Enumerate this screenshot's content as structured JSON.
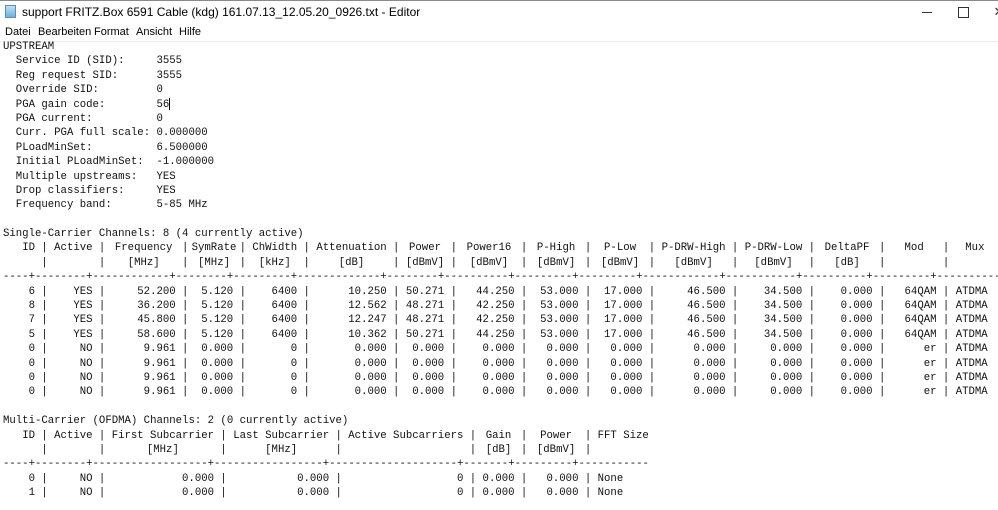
{
  "window": {
    "title": "support FRITZ.Box 6591 Cable (kdg) 161.07.13_12.05.20_0926.txt - Editor",
    "controls": [
      "minimize",
      "maximize",
      "close"
    ]
  },
  "menu": [
    "Datei",
    "Bearbeiten",
    "Format",
    "Ansicht",
    "Hilfe"
  ],
  "document": {
    "heading": "UPSTREAM",
    "settings": [
      {
        "label": "Service ID (SID):",
        "value": "3555"
      },
      {
        "label": "Reg request SID:",
        "value": "3555"
      },
      {
        "label": "Override SID:",
        "value": "0"
      },
      {
        "label": "PGA gain code:",
        "value": "56"
      },
      {
        "label": "PGA current:",
        "value": "0"
      },
      {
        "label": "Curr. PGA full scale:",
        "value": "0.000000"
      },
      {
        "label": "PLoadMinSet:",
        "value": "6.500000"
      },
      {
        "label": "Initial PLoadMinSet:",
        "value": "-1.000000"
      },
      {
        "label": "Multiple upstreams:",
        "value": "YES"
      },
      {
        "label": "Drop classifiers:",
        "value": "YES"
      },
      {
        "label": "Frequency band:",
        "value": "5-85 MHz"
      }
    ],
    "single_carrier": {
      "title": "Single-Carrier Channels: 8 (4 currently active)",
      "headers": [
        "ID",
        "Active",
        "Frequency",
        "SymRate",
        "ChWidth",
        "Attenuation",
        "Power",
        "Power16",
        "P-High",
        "P-Low",
        "P-DRW-High",
        "P-DRW-Low",
        "DeltaPF",
        "Mod",
        "Mux"
      ],
      "units": [
        "",
        "",
        "[MHz]",
        "[MHz]",
        "[kHz]",
        "[dB]",
        "[dBmV]",
        "[dBmV]",
        "[dBmV]",
        "[dBmV]",
        "[dBmV]",
        "[dBmV]",
        "[dB]",
        "",
        ""
      ],
      "rows": [
        [
          "6",
          "YES",
          "52.200",
          "5.120",
          "6400",
          "10.250",
          "50.271",
          "44.250",
          "53.000",
          "17.000",
          "46.500",
          "34.500",
          "0.000",
          "64QAM",
          "ATDMA"
        ],
        [
          "8",
          "YES",
          "36.200",
          "5.120",
          "6400",
          "12.562",
          "48.271",
          "42.250",
          "53.000",
          "17.000",
          "46.500",
          "34.500",
          "0.000",
          "64QAM",
          "ATDMA"
        ],
        [
          "7",
          "YES",
          "45.800",
          "5.120",
          "6400",
          "12.247",
          "48.271",
          "42.250",
          "53.000",
          "17.000",
          "46.500",
          "34.500",
          "0.000",
          "64QAM",
          "ATDMA"
        ],
        [
          "5",
          "YES",
          "58.600",
          "5.120",
          "6400",
          "10.362",
          "50.271",
          "44.250",
          "53.000",
          "17.000",
          "46.500",
          "34.500",
          "0.000",
          "64QAM",
          "ATDMA"
        ],
        [
          "0",
          "NO",
          "9.961",
          "0.000",
          "0",
          "0.000",
          "0.000",
          "0.000",
          "0.000",
          "0.000",
          "0.000",
          "0.000",
          "0.000",
          "er",
          "ATDMA"
        ],
        [
          "0",
          "NO",
          "9.961",
          "0.000",
          "0",
          "0.000",
          "0.000",
          "0.000",
          "0.000",
          "0.000",
          "0.000",
          "0.000",
          "0.000",
          "er",
          "ATDMA"
        ],
        [
          "0",
          "NO",
          "9.961",
          "0.000",
          "0",
          "0.000",
          "0.000",
          "0.000",
          "0.000",
          "0.000",
          "0.000",
          "0.000",
          "0.000",
          "er",
          "ATDMA"
        ],
        [
          "0",
          "NO",
          "9.961",
          "0.000",
          "0",
          "0.000",
          "0.000",
          "0.000",
          "0.000",
          "0.000",
          "0.000",
          "0.000",
          "0.000",
          "er",
          "ATDMA"
        ]
      ]
    },
    "multi_carrier": {
      "title": "Multi-Carrier (OFDMA) Channels: 2 (0 currently active)",
      "headers": [
        "ID",
        "Active",
        "First Subcarrier",
        "Last Subcarrier",
        "Active Subcarriers",
        "Gain",
        "Power",
        "FFT Size"
      ],
      "units": [
        "",
        "",
        "[MHz]",
        "[MHz]",
        "",
        "[dB]",
        "[dBmV]",
        ""
      ],
      "rows": [
        [
          "0",
          "NO",
          "0.000",
          "0.000",
          "0",
          "0.000",
          "0.000",
          "None"
        ],
        [
          "1",
          "NO",
          "0.000",
          "0.000",
          "0",
          "0.000",
          "0.000",
          "None"
        ]
      ]
    }
  }
}
